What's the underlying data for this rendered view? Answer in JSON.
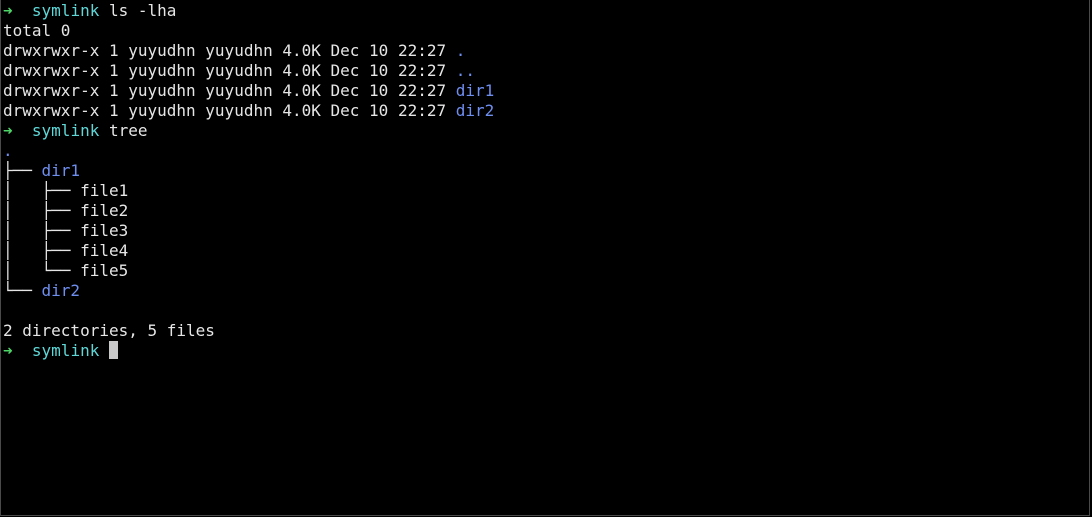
{
  "colors": {
    "background": "#000000",
    "text": "#e6e6e6",
    "prompt_arrow": "#4fd66a",
    "prompt_cwd": "#5fd7d7",
    "directory": "#6f8ff0",
    "cursor": "#c8c8c8"
  },
  "prompt": {
    "arrow": "➜",
    "cwd": "symlink"
  },
  "commands": {
    "ls": "ls -lha",
    "tree": "tree"
  },
  "ls_output": {
    "total": "total 0",
    "rows": [
      {
        "meta": "drwxrwxr-x 1 yuyudhn yuyudhn 4.0K Dec 10 22:27",
        "name": "."
      },
      {
        "meta": "drwxrwxr-x 1 yuyudhn yuyudhn 4.0K Dec 10 22:27",
        "name": ".."
      },
      {
        "meta": "drwxrwxr-x 1 yuyudhn yuyudhn 4.0K Dec 10 22:27",
        "name": "dir1"
      },
      {
        "meta": "drwxrwxr-x 1 yuyudhn yuyudhn 4.0K Dec 10 22:27",
        "name": "dir2"
      }
    ]
  },
  "tree_output": {
    "root": ".",
    "branch_mid": "├── ",
    "branch_last": "└── ",
    "pipe_indent": "│   ",
    "dir1": "dir1",
    "dir1_files": [
      "file1",
      "file2",
      "file3",
      "file4",
      "file5"
    ],
    "dir2": "dir2",
    "summary": "2 directories, 5 files"
  }
}
